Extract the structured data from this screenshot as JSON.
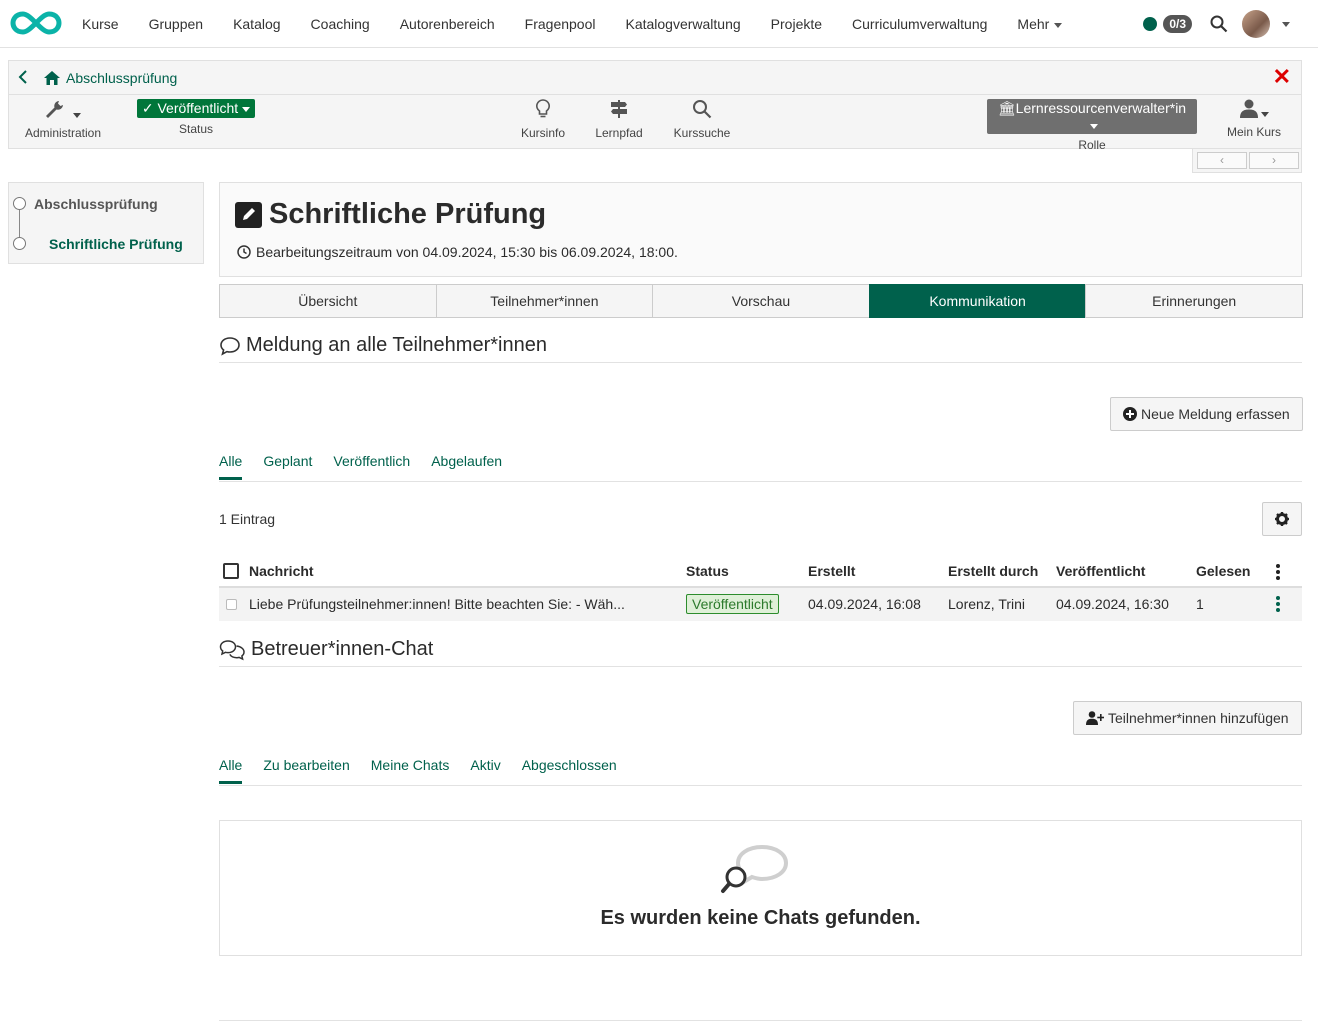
{
  "nav": {
    "items": [
      {
        "label": "Kurse"
      },
      {
        "label": "Gruppen"
      },
      {
        "label": "Katalog"
      },
      {
        "label": "Coaching"
      },
      {
        "label": "Autorenbereich"
      },
      {
        "label": "Fragenpool"
      },
      {
        "label": "Katalogverwaltung"
      },
      {
        "label": "Projekte"
      },
      {
        "label": "Curriculumverwaltung"
      }
    ],
    "more_label": "Mehr",
    "counter": "0/3"
  },
  "course": {
    "breadcrumb_title": "Abschlussprüfung",
    "close_symbol": "✕",
    "tools": {
      "administration": "Administration",
      "status_value": "Veröffentlicht",
      "status_label": "Status",
      "kursinfo": "Kursinfo",
      "lernpfad": "Lernpfad",
      "kurssuche": "Kurssuche",
      "role_value": "Lernressourcenverwalter*in",
      "role_label": "Rolle",
      "mein_kurs": "Mein Kurs"
    },
    "pager": {
      "prev": "‹",
      "next": "›"
    }
  },
  "leftmenu": {
    "items": [
      {
        "label": "Abschlussprüfung"
      },
      {
        "label": "Schriftliche Prüfung"
      }
    ]
  },
  "page": {
    "title": "Schriftliche Prüfung",
    "period": "Bearbeitungszeitraum von 04.09.2024, 15:30 bis 06.09.2024, 18:00.",
    "tabs": [
      {
        "label": "Übersicht"
      },
      {
        "label": "Teilnehmer*innen"
      },
      {
        "label": "Vorschau"
      },
      {
        "label": "Kommunikation"
      },
      {
        "label": "Erinnerungen"
      }
    ]
  },
  "messages": {
    "heading": "Meldung an alle Teilnehmer*innen",
    "new_button": "Neue Meldung erfassen",
    "filters": [
      {
        "label": "Alle"
      },
      {
        "label": "Geplant"
      },
      {
        "label": "Veröffentlich"
      },
      {
        "label": "Abgelaufen"
      }
    ],
    "count": "1 Eintrag",
    "columns": {
      "message": "Nachricht",
      "status": "Status",
      "created": "Erstellt",
      "created_by": "Erstellt durch",
      "published": "Veröffentlicht",
      "read": "Gelesen"
    },
    "rows": [
      {
        "message": "Liebe Prüfungsteilnehmer:innen! Bitte beachten Sie: - Wäh...",
        "status": "Veröffentlicht",
        "created": "04.09.2024, 16:08",
        "created_by": "Lorenz, Trini",
        "published": "04.09.2024, 16:30",
        "read": "1"
      }
    ]
  },
  "chat": {
    "heading": "Betreuer*innen-Chat",
    "add_button": "Teilnehmer*innen hinzufügen",
    "filters": [
      {
        "label": "Alle"
      },
      {
        "label": "Zu bearbeiten"
      },
      {
        "label": "Meine Chats"
      },
      {
        "label": "Aktiv"
      },
      {
        "label": "Abgeschlossen"
      }
    ],
    "empty_text": "Es wurden keine Chats gefunden."
  },
  "colors": {
    "brand": "#00614c",
    "published_green": "#00763a",
    "close_red": "#dd0000"
  }
}
